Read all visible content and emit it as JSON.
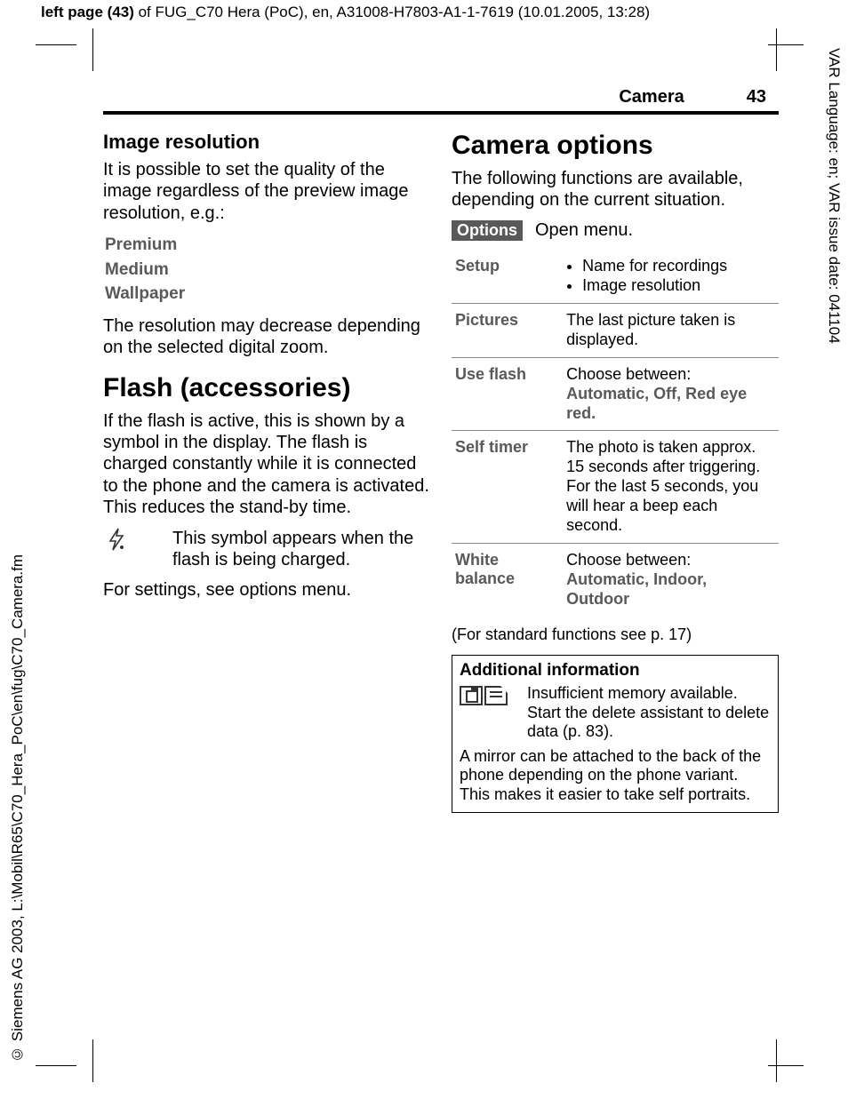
{
  "meta": {
    "top_header_bold": "left page (43)",
    "top_header_rest": " of FUG_C70 Hera (PoC), en, A31008-H7803-A1-1-7619 (10.01.2005, 13:28)",
    "right_margin": "VAR Language: en; VAR issue date: 041104",
    "left_margin": "© Siemens AG 2003, L:\\Mobil\\R65\\C70_Hera_PoC\\en\\fug\\C70_Camera.fm"
  },
  "running": {
    "section": "Camera",
    "page": "43"
  },
  "left": {
    "h_imgres": "Image resolution",
    "p_imgres": "It is possible to set the quality of the image regardless of the preview image resolution, e.g.:",
    "res_options": [
      "Premium",
      "Medium",
      "Wallpaper"
    ],
    "p_zoom": "The resolution may decrease depending on the selected digital zoom.",
    "h_flash": "Flash (accessories)",
    "p_flash": "If the flash is active, this is shown by a symbol in the display. The flash is charged constantly while it is connected to the phone and the camera is activated. This reduces the stand-by time.",
    "flash_symbol_name": "flash-charging-icon",
    "flash_symbol_desc": "This symbol appears when the flash is being charged.",
    "p_settings": "For settings, see options menu."
  },
  "right": {
    "h_options": "Camera options",
    "p_intro": "The following functions are available, depending on the current situation.",
    "options_chip": "Options",
    "options_open": "Open menu.",
    "table": [
      {
        "k": "Setup",
        "v_list": [
          "Name for recordings",
          "Image resolution"
        ]
      },
      {
        "k": "Pictures",
        "v_text": "The last picture taken is displayed."
      },
      {
        "k": "Use flash",
        "v_text": "Choose between:",
        "v_bold": "Automatic, Off, Red eye red."
      },
      {
        "k": "Self timer",
        "v_text": "The photo is taken approx. 15 seconds after triggering. For the last 5 seconds, you will hear a beep each second."
      },
      {
        "k": "White balance",
        "v_text": "Choose between:",
        "v_bold": "Automatic, Indoor, Outdoor"
      }
    ],
    "std_note": "(For standard functions see p. 17)",
    "addl": {
      "heading": "Additional information",
      "mem_text": "Insufficient memory available. Start the delete assistant to delete data (p. 83).",
      "mirror": "A mirror can be attached to the back of the phone depending on the phone variant. This makes it easier to take self portraits."
    }
  }
}
